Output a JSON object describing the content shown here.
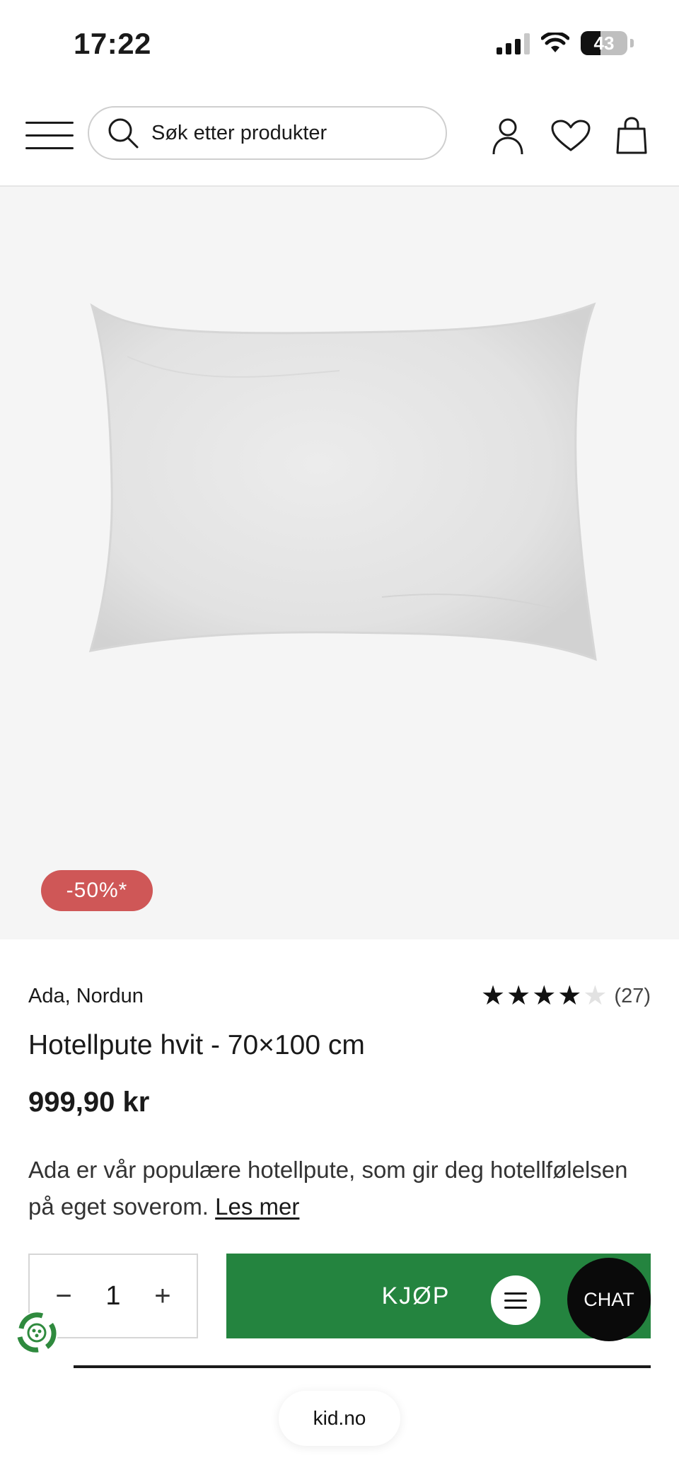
{
  "status_bar": {
    "time": "17:22",
    "battery": "43",
    "battery_level": 0.43
  },
  "header": {
    "search_placeholder": "Søk etter produkter",
    "icons": [
      "menu-icon",
      "search-icon",
      "account-icon",
      "heart-icon",
      "bag-icon"
    ]
  },
  "product": {
    "discount_badge": "-50%*",
    "brand": "Ada, Nordun",
    "rating": {
      "stars_filled": 4,
      "stars_total": 5,
      "count": "(27)"
    },
    "title": "Hotellpute hvit - 70×100 cm",
    "price": "999,90 kr",
    "description": "Ada er vår populære hotellpute, som gir deg hotellfølelsen på eget soverom.",
    "read_more": "Les mer"
  },
  "purchase": {
    "minus": "−",
    "quantity": "1",
    "plus": "+",
    "buy_label": "KJØP",
    "chat_label": "CHAT"
  },
  "browser": {
    "url": "kid.no"
  },
  "colors": {
    "buy_green": "#24843f",
    "badge_red": "#cf5757",
    "hero_bg": "#f5f5f5"
  }
}
